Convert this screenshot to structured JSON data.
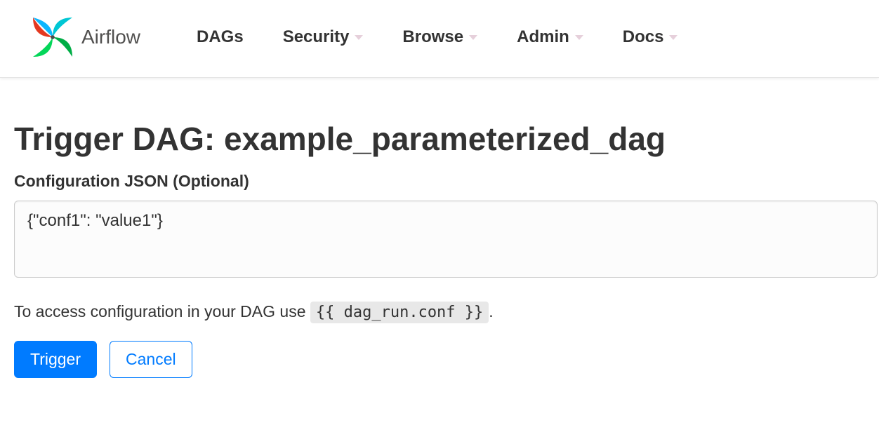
{
  "brand": {
    "name": "Airflow"
  },
  "nav": {
    "items": [
      {
        "label": "DAGs",
        "has_caret": false
      },
      {
        "label": "Security",
        "has_caret": true
      },
      {
        "label": "Browse",
        "has_caret": true
      },
      {
        "label": "Admin",
        "has_caret": true
      },
      {
        "label": "Docs",
        "has_caret": true
      }
    ]
  },
  "page": {
    "title": "Trigger DAG: example_parameterized_dag",
    "config_label": "Configuration JSON (Optional)",
    "config_value": "{\"conf1\": \"value1\"}",
    "hint_prefix": "To access configuration in your DAG use ",
    "hint_code": "{{ dag_run.conf }}",
    "hint_suffix": ".",
    "trigger_label": "Trigger",
    "cancel_label": "Cancel"
  }
}
